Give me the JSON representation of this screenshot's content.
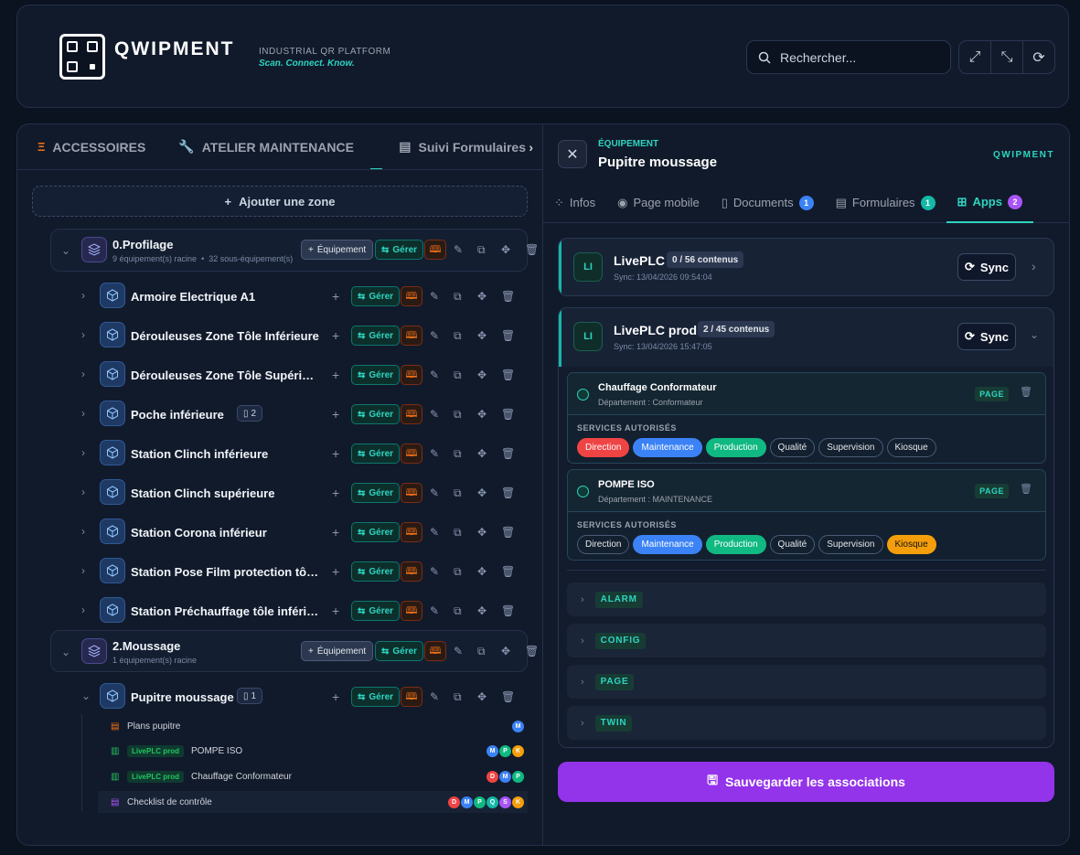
{
  "header": {
    "brand": "QWIPMENT",
    "tagline": "INDUSTRIAL QR PLATFORM",
    "tagline2": "Scan. Connect. Know.",
    "search_placeholder": "Rechercher..."
  },
  "left_tabs": [
    "ACCESSOIRES",
    "ATELIER MAINTENANCE",
    "Suivi Formulaires"
  ],
  "add_zone": "Ajouter une zone",
  "buttons": {
    "equipment": "Équipement",
    "manage": "Gérer"
  },
  "zones": [
    {
      "name": "0.Profilage",
      "roots": "9 équipement(s) racine",
      "sub": "32 sous-équipement(s)"
    },
    {
      "name": "2.Moussage",
      "roots": "1 équipement(s) racine"
    }
  ],
  "equipment": [
    {
      "name": "Armoire Electrique A1"
    },
    {
      "name": "Dérouleuses Zone Tôle Inférieure"
    },
    {
      "name": "Dérouleuses Zone Tôle Supérieure"
    },
    {
      "name": "Poche inférieure",
      "count": "2"
    },
    {
      "name": "Station Clinch inférieure"
    },
    {
      "name": "Station Clinch supérieure"
    },
    {
      "name": "Station Corona inférieur"
    },
    {
      "name": "Station Pose Film protection tôle i..."
    },
    {
      "name": "Station Préchauffage tôle inférieure"
    },
    {
      "name": "Pupitre moussage",
      "count": "1"
    }
  ],
  "docs": [
    {
      "label": "Plans pupitre",
      "dots": [
        "M"
      ]
    },
    {
      "tag": "LivePLC prod",
      "label": "POMPE ISO",
      "dots": [
        "M",
        "P",
        "K"
      ]
    },
    {
      "tag": "LivePLC prod",
      "label": "Chauffage Conformateur",
      "dots": [
        "D",
        "M",
        "P"
      ]
    },
    {
      "label": "Checklist de contrôle",
      "dots": [
        "D",
        "M",
        "P",
        "Q",
        "S",
        "K"
      ]
    }
  ],
  "right": {
    "kicker": "ÉQUIPEMENT",
    "title": "Pupitre moussage",
    "brand": "QWIPMENT",
    "tabs": [
      {
        "label": "Infos"
      },
      {
        "label": "Page mobile"
      },
      {
        "label": "Documents",
        "badge": "1"
      },
      {
        "label": "Formulaires",
        "badge": "1"
      },
      {
        "label": "Apps",
        "badge": "2"
      }
    ],
    "apps": [
      {
        "icon": "LI",
        "name": "LivePLC",
        "count": "0 / 56 contenus",
        "sync": "Sync: 13/04/2026 09:54:04",
        "btn": "Sync"
      },
      {
        "icon": "LI",
        "name": "LivePLC prod",
        "count": "2 / 45 contenus",
        "sync": "Sync: 13/04/2026 15:47:05",
        "btn": "Sync"
      }
    ],
    "pages": [
      {
        "name": "Chauffage Conformateur",
        "dept": "Département : Conformateur",
        "tag": "PAGE",
        "services_label": "SERVICES AUTORISÉS",
        "chips": [
          {
            "label": "Direction",
            "state": "red"
          },
          {
            "label": "Maintenance",
            "state": "blue"
          },
          {
            "label": "Production",
            "state": "green"
          },
          {
            "label": "Qualité",
            "state": ""
          },
          {
            "label": "Supervision",
            "state": ""
          },
          {
            "label": "Kiosque",
            "state": ""
          }
        ]
      },
      {
        "name": "POMPE ISO",
        "dept": "Département : MAINTENANCE",
        "tag": "PAGE",
        "services_label": "SERVICES AUTORISÉS",
        "chips": [
          {
            "label": "Direction",
            "state": ""
          },
          {
            "label": "Maintenance",
            "state": "blue"
          },
          {
            "label": "Production",
            "state": "green"
          },
          {
            "label": "Qualité",
            "state": ""
          },
          {
            "label": "Supervision",
            "state": ""
          },
          {
            "label": "Kiosque",
            "state": "orange"
          }
        ]
      }
    ],
    "sections": [
      "ALARM",
      "CONFIG",
      "PAGE",
      "TWIN"
    ],
    "save": "Sauvegarder les associations"
  },
  "colors": {
    "accent": "#2dd4bf",
    "purple": "#9333ea",
    "D": "#ef4444",
    "M": "#3b82f6",
    "P": "#10b981",
    "Q": "#14b8a6",
    "S": "#a855f7",
    "K": "#f59e0b"
  }
}
